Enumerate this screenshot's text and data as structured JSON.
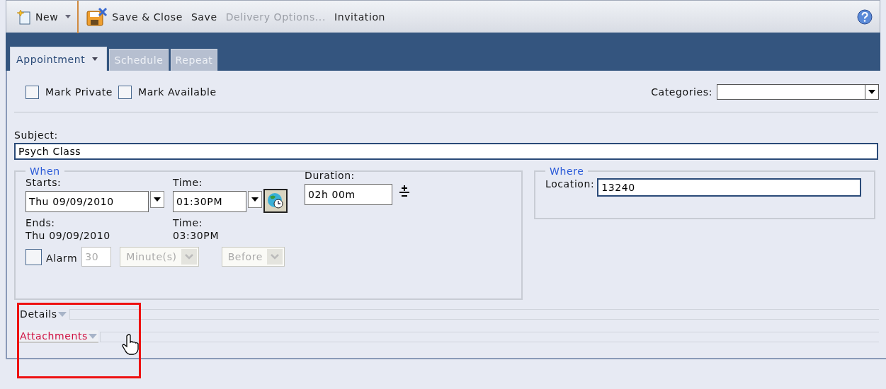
{
  "toolbar": {
    "items": [
      {
        "kind": "new",
        "label": "New",
        "disabled": false
      },
      {
        "kind": "save-close",
        "label": "Save & Close",
        "disabled": false
      },
      {
        "kind": "plain",
        "label": "Save",
        "disabled": false
      },
      {
        "kind": "plain",
        "label": "Delivery Options...",
        "disabled": true
      },
      {
        "kind": "plain",
        "label": "Invitation",
        "disabled": false
      }
    ]
  },
  "tabs": [
    {
      "label": "Appointment",
      "selected": true
    },
    {
      "label": "Schedule",
      "selected": false
    },
    {
      "label": "Repeat",
      "selected": false
    }
  ],
  "options": [
    {
      "label": "Mark Private",
      "checked": false
    },
    {
      "label": "Mark Available",
      "checked": false
    }
  ],
  "categories": {
    "label": "Categories:"
  },
  "subject": {
    "label": "Subject:",
    "value": "Psych Class"
  },
  "when": {
    "legend": "When",
    "starts_label": "Starts:",
    "start_date": "Thu 09/09/2010",
    "start_time_label": "Time:",
    "start_time": "01:30PM",
    "duration_label": "Duration:",
    "duration": "02h 00m",
    "ends_label": "Ends:",
    "end_date": "Thu 09/09/2010",
    "end_time_label": "Time:",
    "end_time": "03:30PM",
    "alarm": {
      "label": "Alarm",
      "checked": false,
      "value": "30",
      "unit": "Minute(s)",
      "relation": "Before",
      "disabled": true
    }
  },
  "where": {
    "legend": "Where",
    "location_label": "Location:",
    "location": "13240"
  },
  "sections": [
    {
      "label": "Details",
      "hovered": false
    },
    {
      "label": "Attachments",
      "hovered": true
    }
  ],
  "highlight_frame": true
}
